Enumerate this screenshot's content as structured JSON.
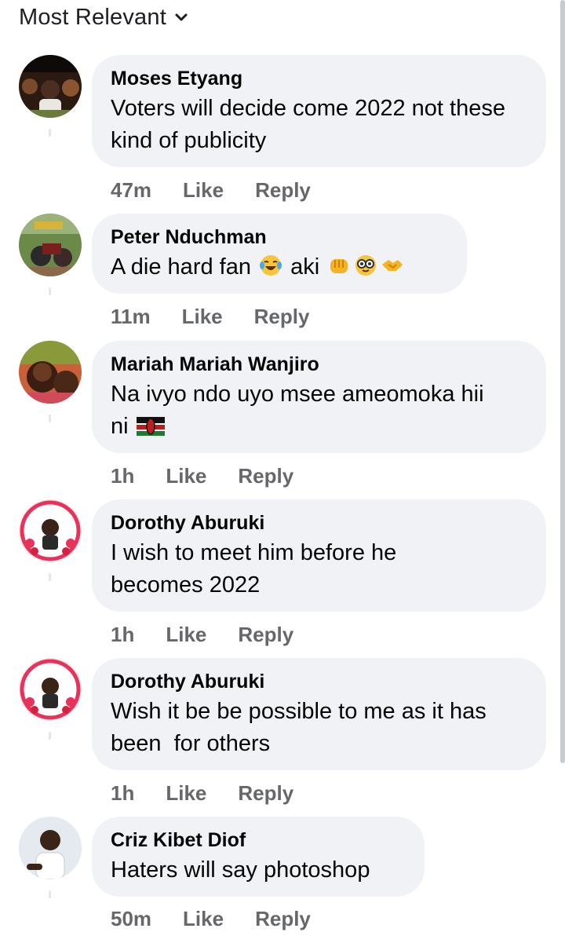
{
  "sort": {
    "label": "Most Relevant",
    "chevron_icon": "chevron-down-icon"
  },
  "colors": {
    "bubble": "#f0f2f5",
    "meta_text": "#65676b",
    "text": "#050505"
  },
  "comments": [
    {
      "author": "Moses Etyang",
      "text": "Voters will decide come 2022 not these kind of publicity",
      "time": "47m",
      "like": "Like",
      "reply": "Reply"
    },
    {
      "author": "Peter Nduchman",
      "text": "A die hard fan",
      "text_after": "aki",
      "emojis": [
        "face-with-tears-of-joy",
        "oncoming-fist",
        "nerd-glasses",
        "handshake"
      ],
      "time": "11m",
      "like": "Like",
      "reply": "Reply"
    },
    {
      "author": "Mariah Mariah Wanjiro",
      "text_line1": "Na ivyo ndo uyo msee ameomoka hii",
      "text_line2": "ni",
      "flag_icon": "kenya-flag-icon",
      "time": "1h",
      "like": "Like",
      "reply": "Reply"
    },
    {
      "author": "Dorothy Aburuki",
      "text": "I wish to meet him before he becomes 2022",
      "time": "1h",
      "like": "Like",
      "reply": "Reply"
    },
    {
      "author": "Dorothy Aburuki",
      "text": "Wish it be be possible to me as it has been  for others",
      "time": "1h",
      "like": "Like",
      "reply": "Reply"
    },
    {
      "author": "Criz Kibet Diof",
      "text": "Haters will say photoshop",
      "time": "50m",
      "like": "Like",
      "reply": "Reply"
    }
  ]
}
